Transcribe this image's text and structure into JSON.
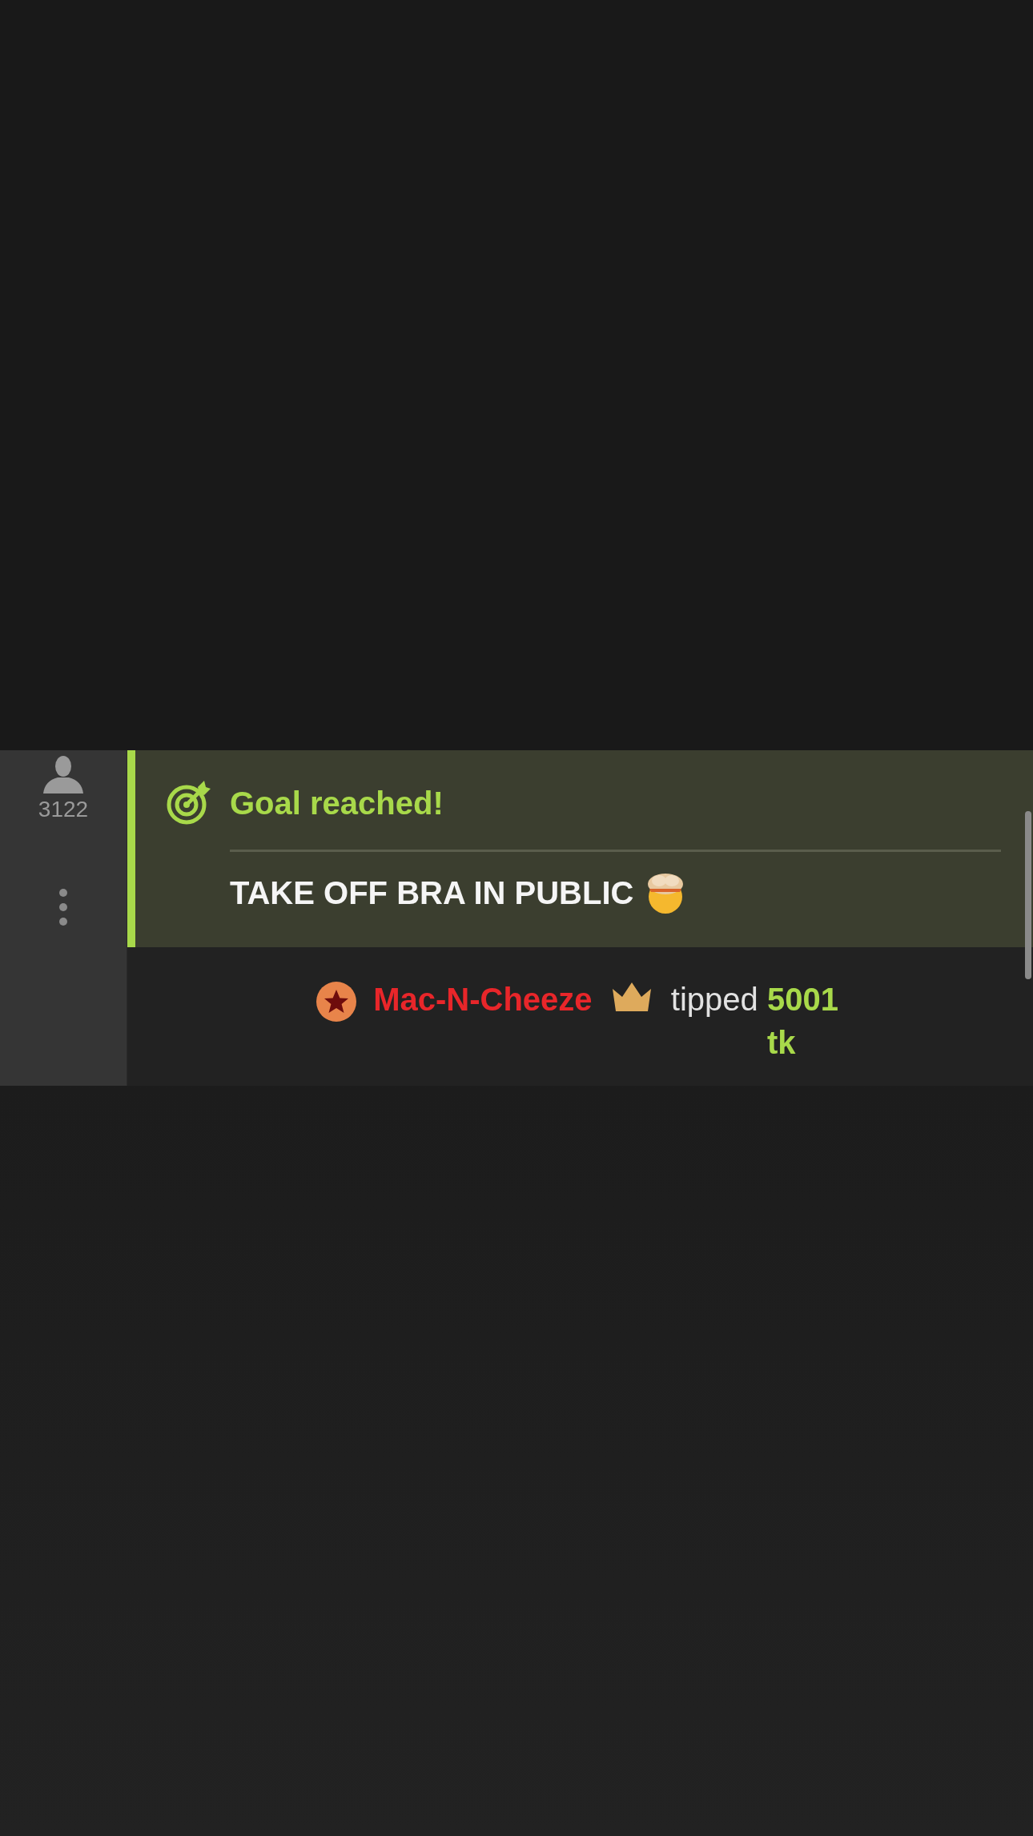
{
  "viewer_panel": {
    "viewer_count": "3122"
  },
  "goal_notice": {
    "title": "Goal reached!",
    "goal": "TAKE OFF BRA IN PUBLIC"
  },
  "tip_message": {
    "username": "Mac-N-Cheeze",
    "action": "tipped",
    "amount": "5001 tk"
  }
}
